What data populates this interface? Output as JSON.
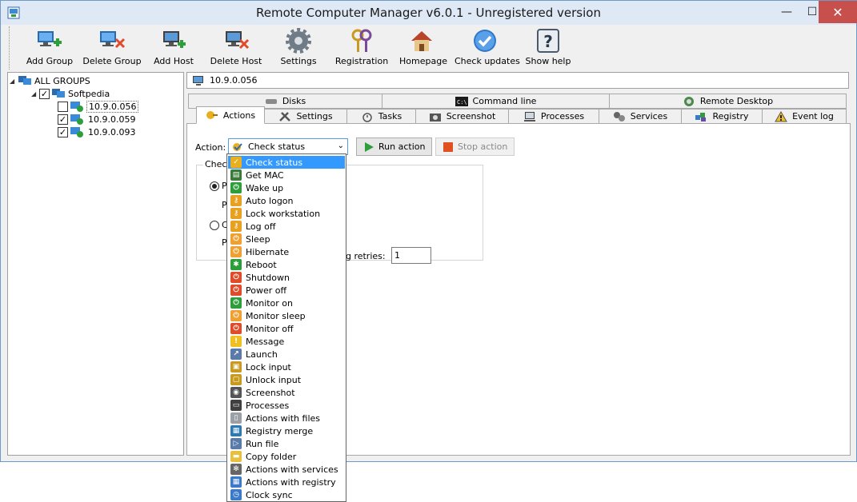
{
  "window": {
    "title": "Remote Computer Manager v6.0.1 - Unregistered version"
  },
  "window_controls": {
    "minimize": "—",
    "maximize": "☐",
    "close": "✕"
  },
  "toolbar": {
    "buttons": [
      {
        "label": "Add Group"
      },
      {
        "label": "Delete Group"
      },
      {
        "label": "Add Host"
      },
      {
        "label": "Delete Host"
      },
      {
        "label": "Settings"
      },
      {
        "label": "Registration"
      },
      {
        "label": "Homepage"
      },
      {
        "label": "Check updates"
      },
      {
        "label": "Show help"
      }
    ]
  },
  "tree": {
    "root": "ALL GROUPS",
    "group": "Softpedia",
    "hosts": [
      {
        "label": "10.9.0.056",
        "checked": false
      },
      {
        "label": "10.9.0.059",
        "checked": true
      },
      {
        "label": "10.9.0.093",
        "checked": true
      }
    ],
    "check_mark": "✓"
  },
  "address": {
    "value": "10.9.0.056"
  },
  "tabs": {
    "row_top": [
      "Disks",
      "Command line",
      "Remote Desktop"
    ],
    "row_bottom": [
      "Actions",
      "Settings",
      "Tasks",
      "Screenshot",
      "Processes",
      "Services",
      "Registry",
      "Event log"
    ],
    "active": "Actions"
  },
  "actions_panel": {
    "action_label": "Action:",
    "selected_action": "Check status",
    "run_action": "Run action",
    "stop_action": "Stop action",
    "group_title": "Check",
    "radio1_label": "Pi",
    "radio1_sub": "Pi",
    "retries_label": "ng retries:",
    "retries_value": "1",
    "radio2_label": "C",
    "radio2_sub": "Po"
  },
  "dropdown": {
    "items": [
      "Check status",
      "Get MAC",
      "Wake up",
      "Auto logon",
      "Lock workstation",
      "Log off",
      "Sleep",
      "Hibernate",
      "Reboot",
      "Shutdown",
      "Power off",
      "Monitor on",
      "Monitor sleep",
      "Monitor off",
      "Message",
      "Launch",
      "Lock input",
      "Unlock input",
      "Screenshot",
      "Processes",
      "Actions with files",
      "Registry merge",
      "Run file",
      "Copy folder",
      "Actions with services",
      "Actions with registry",
      "Clock sync"
    ]
  },
  "colors": {
    "selection": "#3399ff",
    "power_green": "#2e9e3a",
    "power_orange": "#f0a030",
    "power_red": "#e04b2a"
  }
}
